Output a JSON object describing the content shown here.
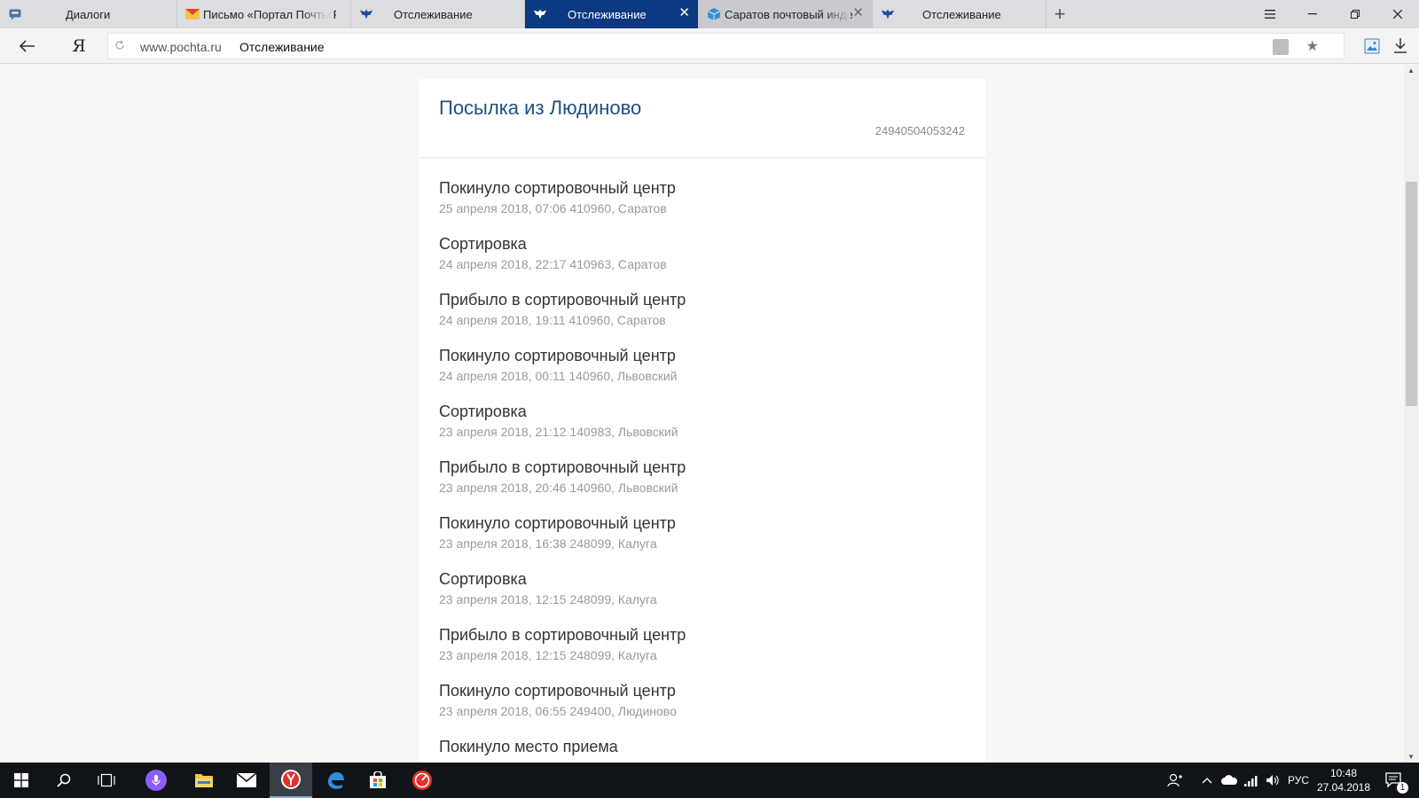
{
  "browser": {
    "tabs": [
      {
        "label": "Диалоги",
        "icon": "vk-messages-icon",
        "active": false
      },
      {
        "label": "Письмо «Портал Почты Ро",
        "icon": "yandex-mail-icon",
        "active": false
      },
      {
        "label": "Отслеживание",
        "icon": "russian-post-eagle-icon",
        "active": false
      },
      {
        "label": "Отслеживание",
        "icon": "russian-post-eagle-icon",
        "active": true
      },
      {
        "label": "Саратов почтовый инде",
        "icon": "cube-icon",
        "active": false
      },
      {
        "label": "Отслеживание",
        "icon": "russian-post-eagle-icon",
        "active": false
      }
    ],
    "new_tab": "+",
    "close_glyph": "✕",
    "address": {
      "domain": "www.pochta.ru",
      "title": "Отслеживание"
    },
    "ya_button": "Я"
  },
  "parcel": {
    "title": "Посылка из Людиново",
    "number": "24940504053242"
  },
  "events": [
    {
      "status": "Покинуло сортировочный центр",
      "meta": "25 апреля 2018, 07:06 410960, Саратов"
    },
    {
      "status": "Сортировка",
      "meta": "24 апреля 2018, 22:17 410963, Саратов"
    },
    {
      "status": "Прибыло в сортировочный центр",
      "meta": "24 апреля 2018, 19:11 410960, Саратов"
    },
    {
      "status": "Покинуло сортировочный центр",
      "meta": "24 апреля 2018, 00:11 140960, Львовский"
    },
    {
      "status": "Сортировка",
      "meta": "23 апреля 2018, 21:12 140983, Львовский"
    },
    {
      "status": "Прибыло в сортировочный центр",
      "meta": "23 апреля 2018, 20:46 140960, Львовский"
    },
    {
      "status": "Покинуло сортировочный центр",
      "meta": "23 апреля 2018, 16:38 248099, Калуга"
    },
    {
      "status": "Сортировка",
      "meta": "23 апреля 2018, 12:15 248099, Калуга"
    },
    {
      "status": "Прибыло в сортировочный центр",
      "meta": "23 апреля 2018, 12:15 248099, Калуга"
    },
    {
      "status": "Покинуло сортировочный центр",
      "meta": "23 апреля 2018, 06:55 249400, Людиново"
    },
    {
      "status": "Покинуло место приема",
      "meta": ""
    }
  ],
  "taskbar": {
    "language": "РУС",
    "time": "10:48",
    "date": "27.04.2018",
    "notification_count": "1"
  },
  "colors": {
    "active_tab": "#0b3a82",
    "title_blue": "#1f4f86",
    "taskbar": "#101418"
  }
}
